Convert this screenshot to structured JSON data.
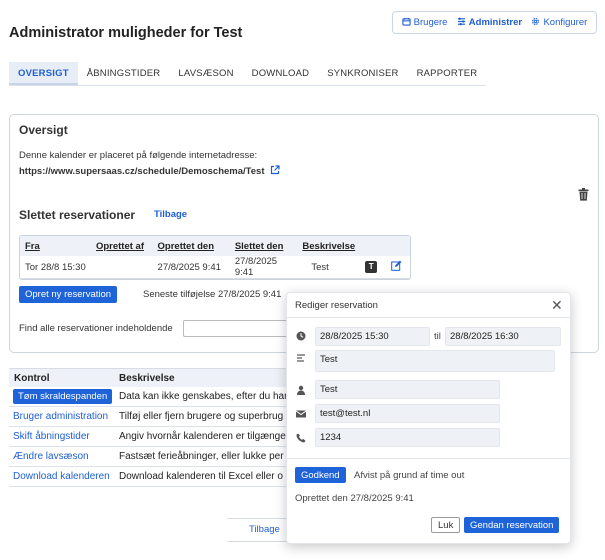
{
  "page_title": "Administrator muligheder for Test",
  "topnav": [
    {
      "label": "Brugere",
      "icon": "calendar-icon"
    },
    {
      "label": "Administrer",
      "icon": "sliders-icon"
    },
    {
      "label": "Konfigurer",
      "icon": "gear-icon"
    }
  ],
  "tabs": [
    "OVERSIGT",
    "ÅBNINGSTIDER",
    "LAVSÆSON",
    "DOWNLOAD",
    "SYNKRONISER",
    "RAPPORTER"
  ],
  "overview": {
    "title": "Oversigt",
    "intro": "Denne kalender er placeret på følgende internetadresse:",
    "url": "https://www.supersaas.cz/schedule/Demoschema/Test"
  },
  "deleted": {
    "title": "Slettet reservationer",
    "back_link": "Tilbage",
    "columns": [
      "Fra",
      "Oprettet af",
      "Oprettet den",
      "Slettet den",
      "Beskrivelse"
    ],
    "rows": [
      {
        "fra": "Tor 28/8 15:30",
        "oprettet_af": "",
        "oprettet_den": "27/8/2025 9:41",
        "slettet_den": "27/8/2025 9:41",
        "beskrivelse": "Test"
      }
    ]
  },
  "new_reservation_button": "Opret ny reservation",
  "latest_addition": "Seneste tilføjelse 27/8/2025 9:41",
  "find_label": "Find alle reservationer indeholdende",
  "control": {
    "headers": [
      "Kontrol",
      "Beskrivelse"
    ],
    "rows": [
      {
        "action": "Tøm skraldespanden",
        "desc": "Data kan ikke genskabes, efter du har"
      },
      {
        "action": "Bruger administration",
        "desc": "Tilføj eller fjern brugere og superbrug"
      },
      {
        "action": "Skift åbningstider",
        "desc": "Angiv hvornår kalenderen er tilgænge"
      },
      {
        "action": "Ændre lavsæson",
        "desc": "Fastsæt ferieåbninger, eller lukke per"
      },
      {
        "action": "Download kalenderen",
        "desc": "Download kalenderen til Excel eller o"
      }
    ]
  },
  "bottom_back": "Tilbage",
  "modal": {
    "title": "Rediger reservation",
    "start": "28/8/2025  15:30",
    "til": "til",
    "end": "28/8/2025  16:30",
    "description": "Test",
    "name": "Test",
    "email": "test@test.nl",
    "phone": "1234",
    "approve_button": "Godkend",
    "status_text": "Afvist på grund af time out",
    "created_text": "Oprettet den 27/8/2025 9:41",
    "close_button": "Luk",
    "restore_button": "Gendan reservation"
  },
  "colors": {
    "accent": "#1f63d8",
    "link": "#1f5fd1"
  }
}
